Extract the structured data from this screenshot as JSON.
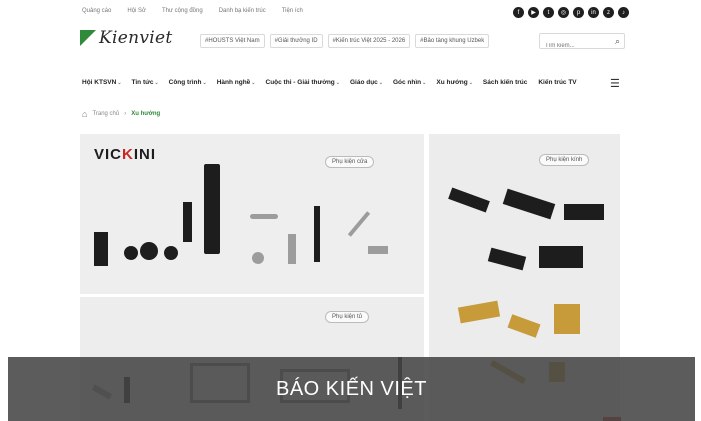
{
  "top_links": [
    "Quảng cáo",
    "Hội Sở",
    "Thư cộng đồng",
    "Danh bạ kiến trúc",
    "Tiện ích"
  ],
  "social_icons": [
    "facebook-icon",
    "youtube-icon",
    "twitter-icon",
    "instagram-icon",
    "pinterest-icon",
    "linkedin-icon",
    "zalo-icon",
    "tiktok-icon"
  ],
  "logo": {
    "text": "Kienviet"
  },
  "header_pills": [
    "#HOUSTS Việt Nam",
    "#Giải thưởng ID",
    "#Kiến trúc Việt 2025 - 2026",
    "#Bảo tàng khung Uzbek"
  ],
  "search": {
    "placeholder": "Tìm kiếm..."
  },
  "nav": {
    "items": [
      {
        "label": "Hội KTSVN",
        "chev": "⌄"
      },
      {
        "label": "Tin tức",
        "chev": "⌄"
      },
      {
        "label": "Công trình",
        "chev": "⌄"
      },
      {
        "label": "Hành nghề",
        "chev": "⌄"
      },
      {
        "label": "Cuộc thi - Giải thưởng",
        "chev": "⌄"
      },
      {
        "label": "Giáo dục",
        "chev": "⌄"
      },
      {
        "label": "Góc nhìn",
        "chev": "⌄"
      },
      {
        "label": "Xu hướng",
        "chev": "⌄"
      },
      {
        "label": "Sách kiến trúc",
        "chev": ""
      },
      {
        "label": "Kiến trúc TV",
        "chev": ""
      }
    ]
  },
  "breadcrumb": {
    "home": "Trang chủ",
    "sep": "›",
    "current": "Xu hướng"
  },
  "images": {
    "main_brand_prefix": "VIC",
    "main_brand_k": "K",
    "main_brand_suffix": "INI",
    "main_tag": "Phụ kiện cửa",
    "side_tag": "Phụ kiện kính",
    "low_tag": "Phụ kiện tủ"
  },
  "overlay": {
    "text": "BÁO KIẾN VIỆT"
  }
}
